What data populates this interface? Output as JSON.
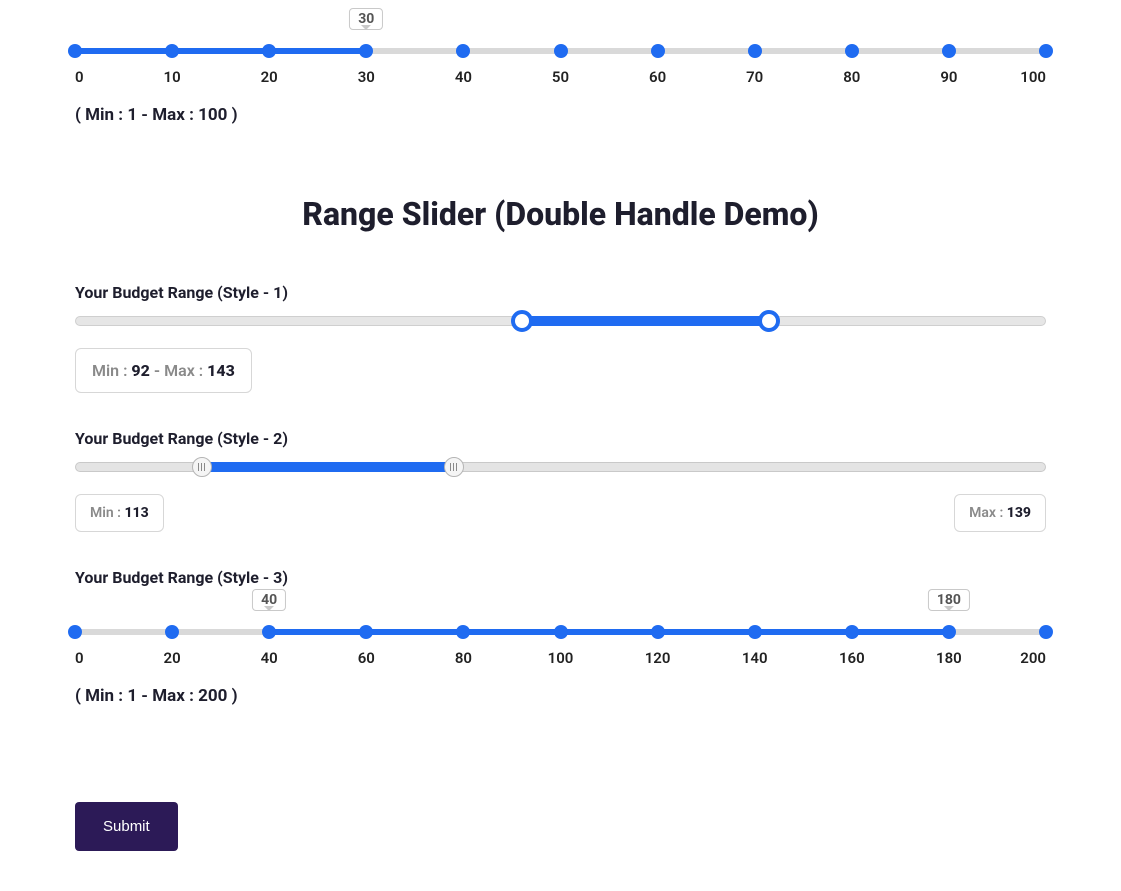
{
  "top_slider": {
    "value": 30,
    "bubble": "30",
    "ticks": [
      "0",
      "10",
      "20",
      "30",
      "40",
      "50",
      "60",
      "70",
      "80",
      "90",
      "100"
    ],
    "minmax_text": "( Min : 1 - Max : 100 )"
  },
  "section_title": "Range Slider (Double Handle Demo)",
  "style1": {
    "label": "Your Budget Range (Style - 1)",
    "low_pct": 46,
    "high_pct": 71.5,
    "box": {
      "min_label": "Min : ",
      "min_value": "92",
      "sep": " - ",
      "max_label": "Max : ",
      "max_value": "143"
    }
  },
  "style2": {
    "label": "Your Budget Range (Style - 2)",
    "low_pct": 13,
    "high_pct": 39,
    "min_box": {
      "label": "Min : ",
      "value": "113"
    },
    "max_box": {
      "label": "Max : ",
      "value": "139"
    }
  },
  "style3": {
    "label": "Your Budget Range (Style - 3)",
    "low_value": 40,
    "high_value": 180,
    "low_bubble": "40",
    "high_bubble": "180",
    "ticks": [
      "0",
      "20",
      "40",
      "60",
      "80",
      "100",
      "120",
      "140",
      "160",
      "180",
      "200"
    ],
    "minmax_text": "( Min : 1 - Max : 200 )"
  },
  "submit_label": "Submit"
}
